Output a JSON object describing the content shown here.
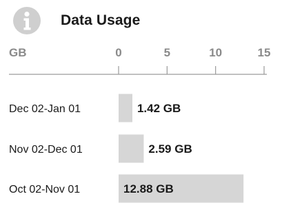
{
  "header": {
    "title": "Data Usage",
    "icon": "info-icon"
  },
  "colors": {
    "bar": "#d6d6d6",
    "axis": "#9a9a9a",
    "muted_text": "#8a8a8a",
    "text": "#1a1a1a",
    "icon": "#cfcfcf"
  },
  "chart_data": {
    "type": "bar",
    "orientation": "horizontal",
    "unit_label": "GB",
    "xlim": [
      0,
      15
    ],
    "ticks": [
      "0",
      "5",
      "10",
      "15"
    ],
    "tick_values": [
      0,
      5,
      10,
      15
    ],
    "grid": false,
    "categories": [
      "Dec 02-Jan 01",
      "Nov 02-Dec 01",
      "Oct 02-Nov 01"
    ],
    "values": [
      1.42,
      2.59,
      12.88
    ],
    "value_labels": [
      "1.42 GB",
      "2.59 GB",
      "12.88 GB"
    ]
  }
}
